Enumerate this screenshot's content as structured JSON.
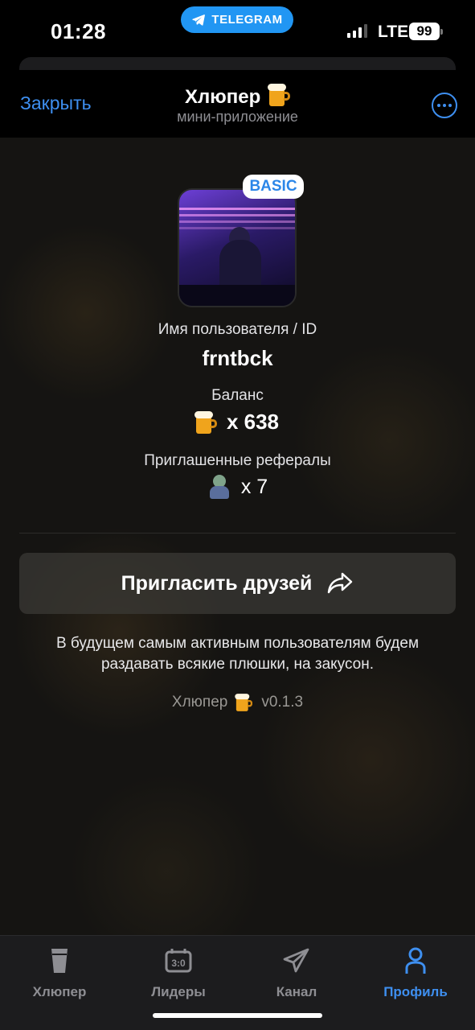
{
  "status_bar": {
    "time": "01:28",
    "telegram_pill": "TELEGRAM",
    "network": "LTE",
    "battery": "99"
  },
  "header": {
    "close_label": "Закрыть",
    "title": "Хлюпер",
    "title_icon": "beer-mug-icon",
    "subtitle": "мини-приложение",
    "menu_icon": "more-dots-icon"
  },
  "profile": {
    "badge": "BASIC",
    "username_label": "Имя пользователя / ID",
    "username": "frntbck",
    "balance_label": "Баланс",
    "balance_value": "x 638",
    "referrals_label": "Приглашенные рефералы",
    "referrals_value": "x 7"
  },
  "invite": {
    "label": "Пригласить друзей",
    "icon": "share-arrow-icon"
  },
  "note": "В будущем самым активным пользователям будем раздавать всякие плюшки, на закусон.",
  "version": {
    "name": "Хлюпер",
    "number": "v0.1.3"
  },
  "tabbar": {
    "tabs": [
      {
        "label": "Хлюпер",
        "icon": "pint-glass-icon",
        "active": false
      },
      {
        "label": "Лидеры",
        "icon": "scoreboard-icon",
        "active": false
      },
      {
        "label": "Канал",
        "icon": "paper-plane-icon",
        "active": false
      },
      {
        "label": "Профиль",
        "icon": "person-icon",
        "active": true
      }
    ]
  },
  "colors": {
    "accent": "#3e8ff0",
    "background": "#151412",
    "tabbar": "#1c1c1e",
    "badge_text": "#2b86e8"
  }
}
